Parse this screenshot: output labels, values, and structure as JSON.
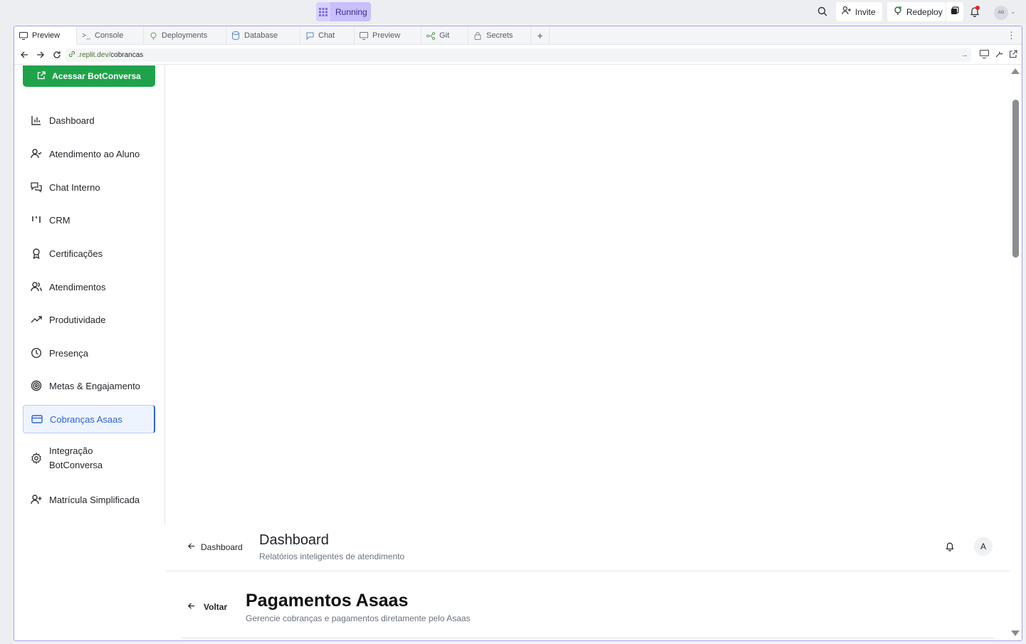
{
  "topbar": {
    "run_status": "Running",
    "invite_label": "Invite",
    "redeploy_label": "Redeploy",
    "user_initials": "AG"
  },
  "tabs": [
    {
      "label": "Preview",
      "icon": "monitor-icon",
      "active": true
    },
    {
      "label": "Console",
      "icon": "terminal-icon"
    },
    {
      "label": "Deployments",
      "icon": "deployments-icon"
    },
    {
      "label": "Database",
      "icon": "database-icon"
    },
    {
      "label": "Chat",
      "icon": "chat-icon"
    },
    {
      "label": "Preview",
      "icon": "monitor-icon"
    },
    {
      "label": "Git",
      "icon": "git-icon"
    },
    {
      "label": "Secrets",
      "icon": "lock-icon"
    }
  ],
  "url": {
    "host": ".replit.dev/",
    "path": "cobrancas"
  },
  "sidebar": {
    "botconversa_button": "Acessar BotConversa",
    "items": [
      {
        "label": "Dashboard",
        "icon": "bar-chart-icon"
      },
      {
        "label": "Atendimento ao Aluno",
        "icon": "user-check-icon"
      },
      {
        "label": "Chat Interno",
        "icon": "messages-icon"
      },
      {
        "label": "CRM",
        "icon": "kanban-icon"
      },
      {
        "label": "Certificações",
        "icon": "award-icon"
      },
      {
        "label": "Atendimentos",
        "icon": "users-icon"
      },
      {
        "label": "Produtividade",
        "icon": "trending-up-icon"
      },
      {
        "label": "Presença",
        "icon": "clock-icon"
      },
      {
        "label": "Metas & Engajamento",
        "icon": "target-icon"
      },
      {
        "label": "Cobranças Asaas",
        "icon": "credit-card-icon",
        "active": true
      },
      {
        "label": "Integração BotConversa",
        "label_line1": "Integração",
        "label_line2": "BotConversa",
        "icon": "settings-icon"
      },
      {
        "label": "Matrícula Simplificada",
        "icon": "user-plus-icon"
      }
    ]
  },
  "header": {
    "back_label": "Dashboard",
    "title": "Dashboard",
    "subtitle": "Relatórios inteligentes de atendimento",
    "avatar_initial": "A"
  },
  "page": {
    "back_label": "Voltar",
    "title": "Pagamentos Asaas",
    "subtitle": "Gerencie cobranças e pagamentos diretamente pelo Asaas"
  },
  "colors": {
    "accent": "#2e64d0",
    "botconversa_green": "#1fa34a",
    "running_purple": "#c9bffb"
  }
}
